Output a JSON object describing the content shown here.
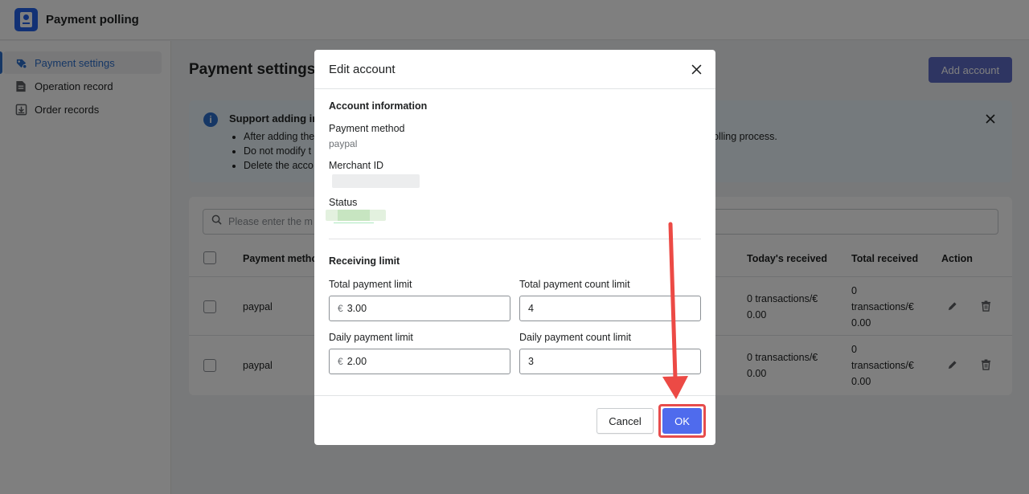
{
  "app": {
    "title": "Payment polling",
    "logo_icon": "app-logo-icon"
  },
  "sidebar": {
    "items": [
      {
        "label": "Payment settings",
        "icon": "payment-settings-icon",
        "active": true
      },
      {
        "label": "Operation record",
        "icon": "document-icon",
        "active": false
      },
      {
        "label": "Order records",
        "icon": "download-icon",
        "active": false
      }
    ]
  },
  "main": {
    "title": "Payment settings",
    "add_button": "Add account",
    "banner": {
      "title": "Support adding in",
      "bullets": [
        "After adding the",
        "Do not modify t",
        "Delete the acco"
      ],
      "tail": "olling process."
    },
    "search": {
      "placeholder": "Please enter the m"
    },
    "table": {
      "headers": [
        "Payment metho",
        "Today's received",
        "Total received",
        "Action"
      ],
      "rows": [
        {
          "method": "paypal",
          "today_1": "0 transactions/€",
          "today_2": "0.00",
          "total_1": "0",
          "total_2": "transactions/€",
          "total_3": "0.00"
        },
        {
          "method": "paypal",
          "today_1": "0 transactions/€",
          "today_2": "0.00",
          "total_1": "0",
          "total_2": "transactions/€",
          "total_3": "0.00"
        }
      ]
    }
  },
  "modal": {
    "title": "Edit account",
    "account_section": "Account information",
    "payment_method_label": "Payment method",
    "payment_method_value": "paypal",
    "merchant_id_label": "Merchant ID",
    "status_label": "Status",
    "limit_section": "Receiving limit",
    "total_payment_limit_label": "Total payment limit",
    "total_payment_limit_value": "3.00",
    "total_count_limit_label": "Total payment count limit",
    "total_count_limit_value": "4",
    "daily_payment_limit_label": "Daily payment limit",
    "daily_payment_limit_value": "2.00",
    "daily_count_limit_label": "Daily payment count limit",
    "daily_count_limit_value": "3",
    "currency_prefix": "€",
    "cancel_label": "Cancel",
    "ok_label": "OK"
  },
  "colors": {
    "accent": "#5c6ac4",
    "ok": "#4f6bed",
    "highlight": "#e74c4c",
    "active_nav": "#2c6ecb"
  }
}
